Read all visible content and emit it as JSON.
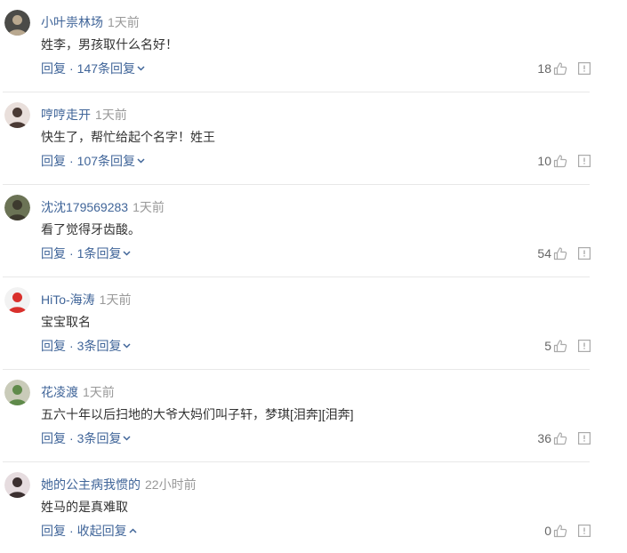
{
  "icons": {
    "like": "thumb-up-icon",
    "report": "report-icon"
  },
  "colors": {
    "username": "#406599",
    "time": "#999999",
    "text": "#333333",
    "reply": "#406599",
    "likes": "#666666",
    "icon": "#aaaaaa",
    "divider": "#e8e8e8"
  },
  "comments": [
    {
      "username": "小叶祟林场",
      "time": "1天前",
      "text": "姓李，男孩取什么名好！",
      "reply_label": "回复",
      "separator": "·",
      "replies_label": "147条回复",
      "chevron_icon": "chevron-down-icon",
      "likes": "18",
      "avatar": {
        "bg": "#4b4b48",
        "fg": "#b9a88f"
      }
    },
    {
      "username": "哼哼走开",
      "time": "1天前",
      "text": "快生了，帮忙给起个名字！姓王",
      "reply_label": "回复",
      "separator": "·",
      "replies_label": "107条回复",
      "chevron_icon": "chevron-down-icon",
      "likes": "10",
      "avatar": {
        "bg": "#e9dfdb",
        "fg": "#4a3a34"
      }
    },
    {
      "username": "沈沈179569283",
      "time": "1天前",
      "text": "看了觉得牙齿酸。",
      "reply_label": "回复",
      "separator": "·",
      "replies_label": "1条回复",
      "chevron_icon": "chevron-down-icon",
      "likes": "54",
      "avatar": {
        "bg": "#6b7355",
        "fg": "#3d3a2e"
      }
    },
    {
      "username": "HiTo-海涛",
      "time": "1天前",
      "text": "宝宝取名",
      "reply_label": "回复",
      "separator": "·",
      "replies_label": "3条回复",
      "chevron_icon": "chevron-down-icon",
      "likes": "5",
      "avatar": {
        "bg": "#f2f2f2",
        "fg": "#d9302c"
      }
    },
    {
      "username": "花凌渡",
      "time": "1天前",
      "text": "五六十年以后扫地的大爷大妈们叫子轩，梦琪[泪奔][泪奔]",
      "reply_label": "回复",
      "separator": "·",
      "replies_label": "3条回复",
      "chevron_icon": "chevron-down-icon",
      "likes": "36",
      "avatar": {
        "bg": "#c9cbb9",
        "fg": "#5f8a4a"
      }
    },
    {
      "username": "她的公主病我惯的",
      "time": "22小时前",
      "text": "姓马的是真难取",
      "reply_label": "回复",
      "separator": "·",
      "replies_label": "收起回复",
      "chevron_icon": "chevron-up-icon",
      "likes": "0",
      "avatar": {
        "bg": "#e6dcdf",
        "fg": "#3c3030"
      }
    }
  ]
}
